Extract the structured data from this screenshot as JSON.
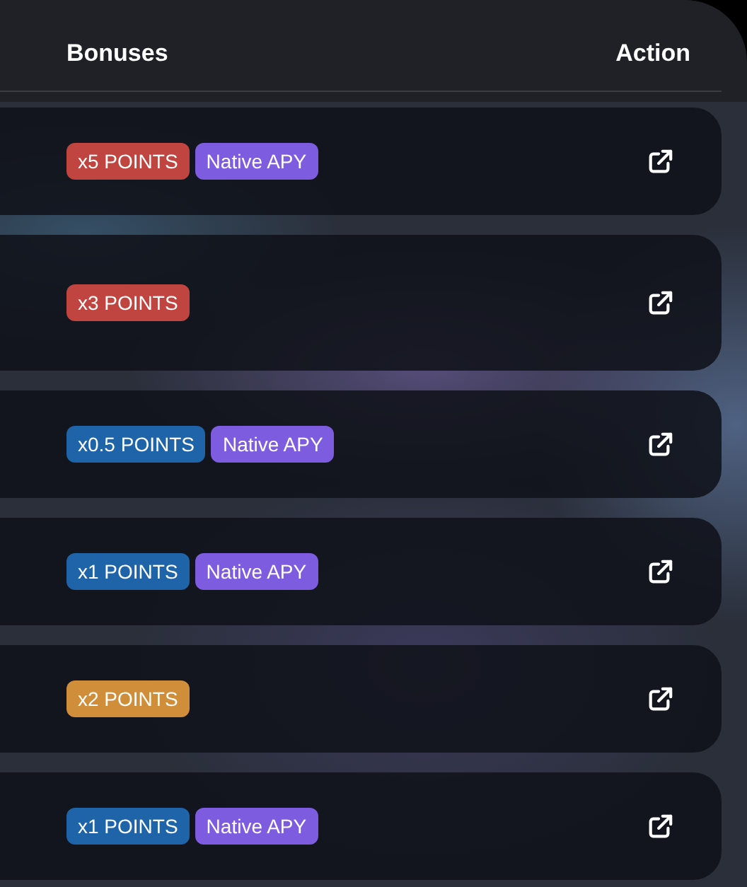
{
  "header": {
    "columns": [
      "Bonuses",
      "Action"
    ]
  },
  "rows": [
    {
      "tags": [
        {
          "text": "x5 POINTS",
          "color": "#c0443f"
        },
        {
          "text": "Native APY",
          "color": "#7d5ce0"
        }
      ]
    },
    {
      "tags": [
        {
          "text": "x3 POINTS",
          "color": "#c0443f"
        }
      ]
    },
    {
      "tags": [
        {
          "text": "x0.5 POINTS",
          "color": "#1f63a8"
        },
        {
          "text": "Native APY",
          "color": "#7d5ce0"
        }
      ]
    },
    {
      "tags": [
        {
          "text": "x1 POINTS",
          "color": "#1f63a8"
        },
        {
          "text": "Native APY",
          "color": "#7d5ce0"
        }
      ]
    },
    {
      "tags": [
        {
          "text": "x2 POINTS",
          "color": "#d08d3a"
        }
      ]
    },
    {
      "tags": [
        {
          "text": "x1 POINTS",
          "color": "#1f63a8"
        },
        {
          "text": "Native APY",
          "color": "#7d5ce0"
        }
      ]
    }
  ]
}
